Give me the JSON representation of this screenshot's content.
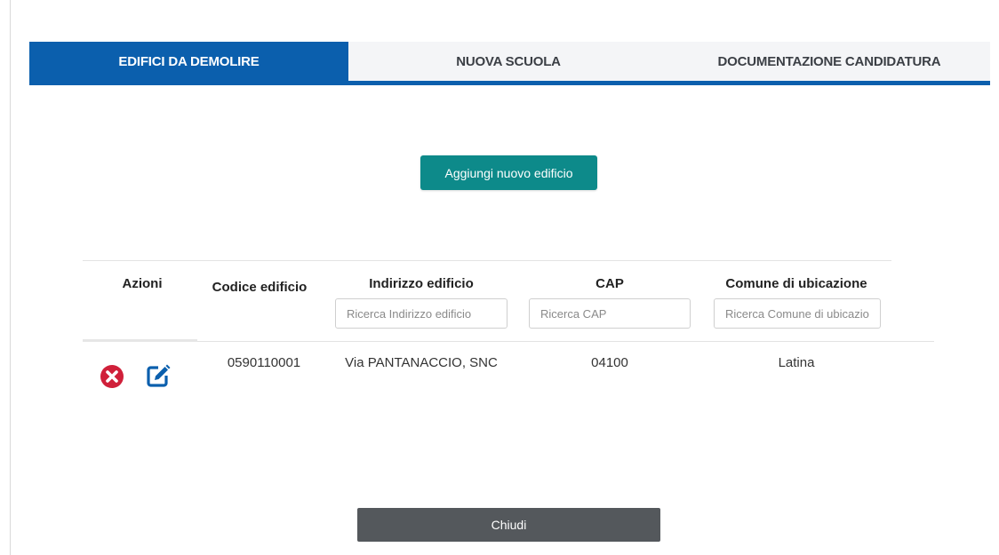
{
  "tabs": [
    {
      "label": "EDIFICI DA DEMOLIRE",
      "active": true
    },
    {
      "label": "NUOVA SCUOLA",
      "active": false
    },
    {
      "label": "DOCUMENTAZIONE CANDIDATURA",
      "active": false
    }
  ],
  "actions": {
    "add_building_label": "Aggiungi nuovo edificio",
    "close_label": "Chiudi"
  },
  "table": {
    "headers": {
      "azioni": "Azioni",
      "codice": "Codice edificio",
      "indirizzo": "Indirizzo edificio",
      "cap": "CAP",
      "comune": "Comune di ubicazione"
    },
    "filters": {
      "indirizzo_placeholder": "Ricerca Indirizzo edificio",
      "cap_placeholder": "Ricerca CAP",
      "comune_placeholder": "Ricerca Comune di ubicazione"
    },
    "rows": [
      {
        "codice": "0590110001",
        "indirizzo": "Via PANTANACCIO, SNC",
        "cap": "04100",
        "comune": "Latina",
        "row_icons": [
          "delete-icon",
          "edit-icon"
        ]
      }
    ]
  },
  "colors": {
    "primary": "#0b5fad",
    "add_button": "#0d8a8a",
    "delete": "#d0203a",
    "edit": "#0b5fad",
    "close_button": "#54585c"
  }
}
